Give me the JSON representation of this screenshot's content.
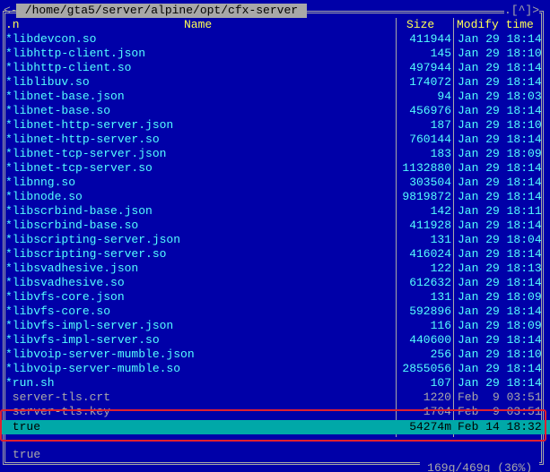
{
  "panel": {
    "path": " /home/gta5/server/alpine/opt/cfx-server ",
    "corner_left": "<-",
    "corner_right": ".[^]>",
    "headers": {
      "sort": ".n",
      "name": "Name",
      "size": "Size",
      "modify": "Modify time"
    },
    "rows": [
      {
        "name": "*libdevcon.so",
        "size": "411944",
        "date": "Jan 29 18:14",
        "style": "exec"
      },
      {
        "name": "*libhttp-client.json",
        "size": "145",
        "date": "Jan 29 18:10",
        "style": "exec"
      },
      {
        "name": "*libhttp-client.so",
        "size": "497944",
        "date": "Jan 29 18:14",
        "style": "exec"
      },
      {
        "name": "*liblibuv.so",
        "size": "174072",
        "date": "Jan 29 18:14",
        "style": "exec"
      },
      {
        "name": "*libnet-base.json",
        "size": "94",
        "date": "Jan 29 18:03",
        "style": "exec"
      },
      {
        "name": "*libnet-base.so",
        "size": "456976",
        "date": "Jan 29 18:14",
        "style": "exec"
      },
      {
        "name": "*libnet-http-server.json",
        "size": "187",
        "date": "Jan 29 18:10",
        "style": "exec"
      },
      {
        "name": "*libnet-http-server.so",
        "size": "760144",
        "date": "Jan 29 18:14",
        "style": "exec"
      },
      {
        "name": "*libnet-tcp-server.json",
        "size": "183",
        "date": "Jan 29 18:09",
        "style": "exec"
      },
      {
        "name": "*libnet-tcp-server.so",
        "size": "1132880",
        "date": "Jan 29 18:14",
        "style": "exec"
      },
      {
        "name": "*libnng.so",
        "size": "303504",
        "date": "Jan 29 18:14",
        "style": "exec"
      },
      {
        "name": "*libnode.so",
        "size": "9819872",
        "date": "Jan 29 18:14",
        "style": "exec"
      },
      {
        "name": "*libscrbind-base.json",
        "size": "142",
        "date": "Jan 29 18:11",
        "style": "exec"
      },
      {
        "name": "*libscrbind-base.so",
        "size": "411928",
        "date": "Jan 29 18:14",
        "style": "exec"
      },
      {
        "name": "*libscripting-server.json",
        "size": "131",
        "date": "Jan 29 18:04",
        "style": "exec"
      },
      {
        "name": "*libscripting-server.so",
        "size": "416024",
        "date": "Jan 29 18:14",
        "style": "exec"
      },
      {
        "name": "*libsvadhesive.json",
        "size": "122",
        "date": "Jan 29 18:13",
        "style": "exec"
      },
      {
        "name": "*libsvadhesive.so",
        "size": "612632",
        "date": "Jan 29 18:14",
        "style": "exec"
      },
      {
        "name": "*libvfs-core.json",
        "size": "131",
        "date": "Jan 29 18:09",
        "style": "exec"
      },
      {
        "name": "*libvfs-core.so",
        "size": "592896",
        "date": "Jan 29 18:14",
        "style": "exec"
      },
      {
        "name": "*libvfs-impl-server.json",
        "size": "116",
        "date": "Jan 29 18:09",
        "style": "exec"
      },
      {
        "name": "*libvfs-impl-server.so",
        "size": "440600",
        "date": "Jan 29 18:14",
        "style": "exec"
      },
      {
        "name": "*libvoip-server-mumble.json",
        "size": "256",
        "date": "Jan 29 18:10",
        "style": "exec"
      },
      {
        "name": "*libvoip-server-mumble.so",
        "size": "2855056",
        "date": "Jan 29 18:14",
        "style": "exec"
      },
      {
        "name": "*run.sh",
        "size": "107",
        "date": "Jan 29 18:14",
        "style": "exec"
      },
      {
        "name": " server-tls.crt",
        "size": "1220",
        "date": "Feb  9 03:51",
        "style": "plain"
      },
      {
        "name": " server-tls.key",
        "size": "1704",
        "date": "Feb  9 03:51",
        "style": "plain"
      },
      {
        "name": " true",
        "size": "54274m",
        "date": "Feb 14 18:32",
        "style": "selected"
      }
    ],
    "status_name": "true",
    "footer": " 169g/469g (36%) "
  },
  "colors": {
    "background": "#0000a8",
    "exec_file": "#54ffff",
    "plain_file": "#a8a8a8",
    "header": "#ffff54",
    "selection": "#00a8a8",
    "annotation_box": "#e02030"
  }
}
